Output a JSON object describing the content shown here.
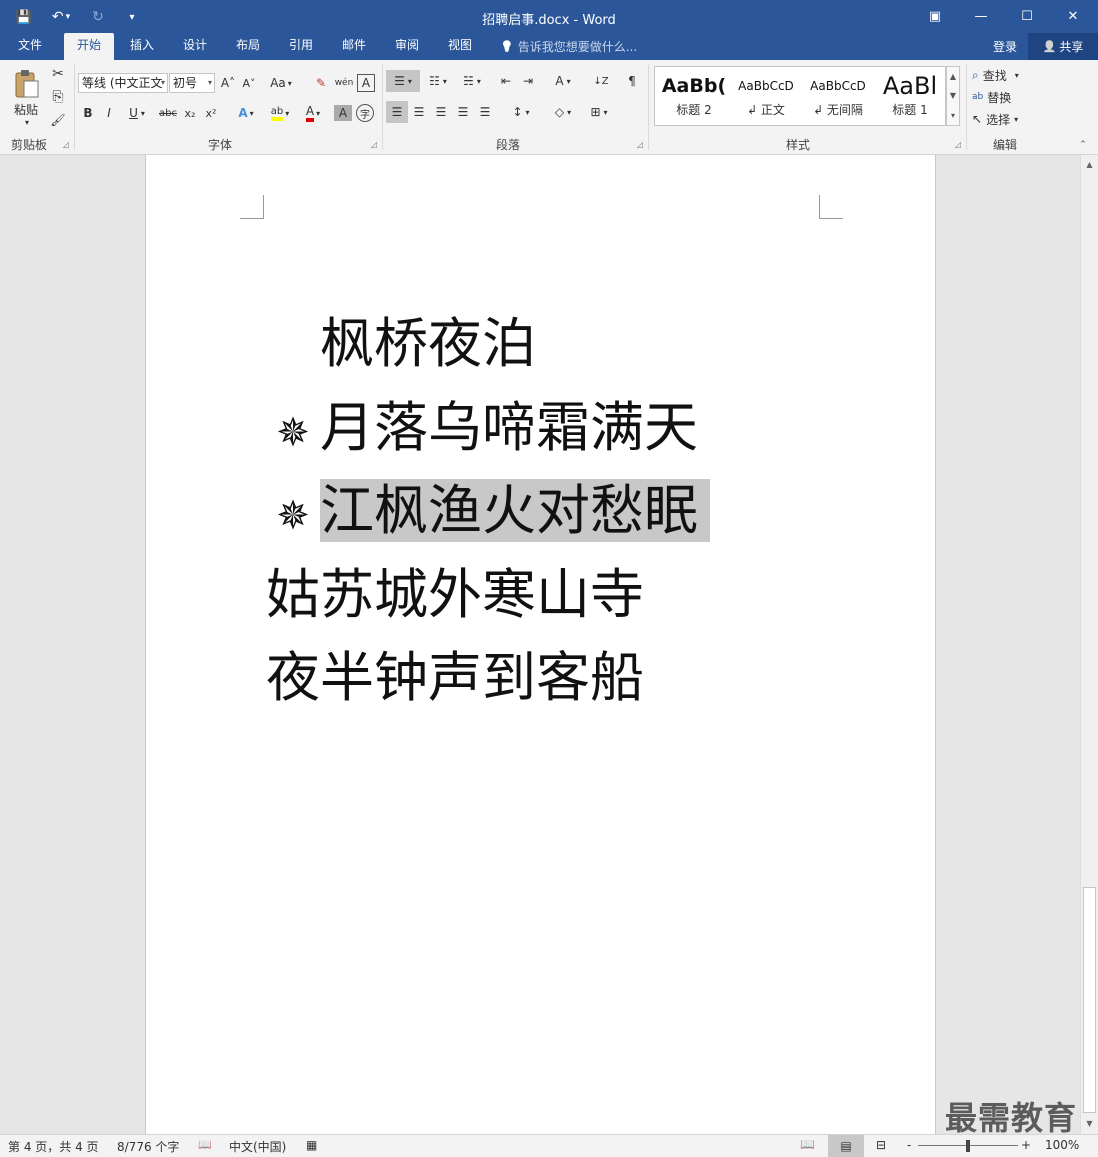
{
  "window": {
    "title": "招聘启事.docx - Word",
    "controls": {
      "ribbon_display": "▣",
      "minimize": "—",
      "maximize": "☐",
      "close": "✕"
    }
  },
  "qat": {
    "save": "💾",
    "undo": "↶",
    "undo_drop": "▾",
    "redo": "↻",
    "customize": "▾"
  },
  "tabs": [
    "文件",
    "开始",
    "插入",
    "设计",
    "布局",
    "引用",
    "邮件",
    "审阅",
    "视图"
  ],
  "active_tab": "开始",
  "tell_me": {
    "icon": "💡",
    "placeholder": "告诉我您想要做什么..."
  },
  "account": {
    "login": "登录",
    "share": "共享",
    "share_icon": "👤"
  },
  "ribbon": {
    "clipboard": {
      "paste": "粘贴",
      "cut": "✂",
      "copy": "⎘",
      "format_painter": "🖌",
      "label": "剪贴板"
    },
    "font": {
      "font_name": "等线 (中文正文",
      "font_size": "初号",
      "grow": "A˄",
      "shrink": "A˅",
      "change_case": "Aa",
      "clear": "✎",
      "phonetic": "wén",
      "border": "A",
      "bold": "B",
      "italic": "I",
      "underline": "U",
      "strike": "abc",
      "subscript": "x₂",
      "superscript": "x²",
      "effects": "A",
      "highlight": "ab",
      "color": "A",
      "shading": "A",
      "enclose": "字",
      "label": "字体"
    },
    "paragraph": {
      "bullets": "☰",
      "numbering": "☷",
      "multilevel": "☵",
      "dec_indent": "⇤",
      "inc_indent": "⇥",
      "cjk": "A",
      "sort": "↓Z",
      "marks": "¶",
      "align_left": "☰",
      "center": "☰",
      "align_right": "☰",
      "justify": "☰",
      "distributed": "☰",
      "spacing": "↕",
      "shading": "◇",
      "borders": "⊞",
      "label": "段落"
    },
    "styles": {
      "items": [
        {
          "preview": "AaBb(",
          "name": "标题 2"
        },
        {
          "preview": "AaBbCcD",
          "name": "↲ 正文"
        },
        {
          "preview": "AaBbCcD",
          "name": "↲ 无间隔"
        },
        {
          "preview": "AaBl",
          "name": "标题 1"
        }
      ],
      "label": "样式"
    },
    "editing": {
      "find": "查找",
      "replace": "替换",
      "select": "选择",
      "label": "编辑"
    }
  },
  "document": {
    "lines": [
      {
        "bullet": "",
        "text": "枫桥夜泊",
        "indent": true,
        "highlight": false
      },
      {
        "bullet": "✵",
        "text": "月落乌啼霜满天",
        "indent": false,
        "highlight": false
      },
      {
        "bullet": "✵",
        "text": "江枫渔火对愁眠",
        "indent": false,
        "highlight": true
      },
      {
        "bullet": "",
        "text": "姑苏城外寒山寺",
        "indent": false,
        "highlight": false
      },
      {
        "bullet": "",
        "text": "夜半钟声到客船",
        "indent": false,
        "highlight": false
      }
    ]
  },
  "status": {
    "page": "第 4 页，共 4 页",
    "words": "8/776 个字",
    "proof_icon": "📖",
    "language": "中文(中国)",
    "macro_icon": "▦",
    "zoom_minus": "-",
    "zoom_plus": "+",
    "zoom": "100%",
    "zoom_fraction": 0.5
  },
  "watermark": "最需教育"
}
